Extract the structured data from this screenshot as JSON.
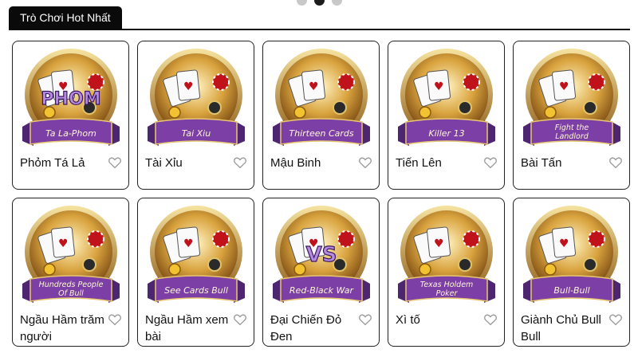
{
  "carousel": {
    "count": 3,
    "active": 1
  },
  "section": {
    "title": "Trò Chơi Hot Nhất"
  },
  "games": [
    {
      "name": "Phỏm Tá Lả",
      "banner": "Ta La-Phom",
      "logo": "PHOM",
      "icon": "cards-phom-icon",
      "accent": "#7b3fa6"
    },
    {
      "name": "Tài Xỉu",
      "banner": "Tai Xiu",
      "logo": "",
      "icon": "dice-cup-icon",
      "accent": "#7b3fa6"
    },
    {
      "name": "Mậu Binh",
      "banner": "Thirteen Cards",
      "logo": "",
      "icon": "revolver-cards-icon",
      "accent": "#7b3fa6"
    },
    {
      "name": "Tiến Lên",
      "banner": "Killer 13",
      "logo": "",
      "icon": "bomb-cards-icon",
      "accent": "#7b3fa6"
    },
    {
      "name": "Bài Tấn",
      "banner": "Fight the Landlord",
      "logo": "",
      "icon": "landlord-character-icon",
      "accent": "#7b3fa6"
    },
    {
      "name": "Ngầu Hầm trăm người",
      "banner": "Hundreds People Of Bull",
      "logo": "",
      "icon": "cowboy-hat-cards-icon",
      "accent": "#7b3fa6"
    },
    {
      "name": "Ngầu Hầm xem bài",
      "banner": "See Cards Bull",
      "logo": "",
      "icon": "bull-character-icon",
      "accent": "#7b3fa6"
    },
    {
      "name": "Đại Chiến Đỏ Đen",
      "banner": "Red-Black War",
      "logo": "VS",
      "icon": "red-black-cards-icon",
      "accent": "#7b3fa6"
    },
    {
      "name": "Xì tố",
      "banner": "Texas Holdem Poker",
      "logo": "",
      "icon": "crown-cards-icon",
      "accent": "#7b3fa6"
    },
    {
      "name": "Giành Chủ Bull Bull",
      "banner": "Bull-Bull",
      "logo": "",
      "icon": "golden-bull-icon",
      "accent": "#7b3fa6"
    }
  ]
}
